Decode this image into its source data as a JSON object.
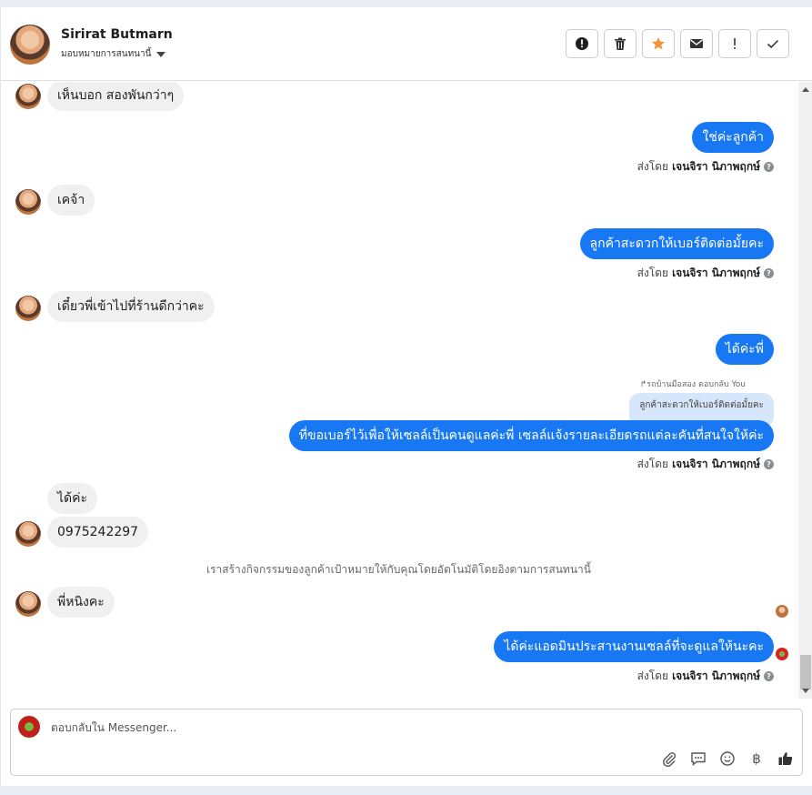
{
  "header": {
    "contact_name": "Sirirat Butmarn",
    "assign_label": "มอบหมายการสนทนานี้",
    "toolbar": [
      {
        "name": "spam-button",
        "icon": "alert-circle-icon"
      },
      {
        "name": "delete-button",
        "icon": "trash-icon"
      },
      {
        "name": "star-button",
        "icon": "star-icon"
      },
      {
        "name": "mark-unread-button",
        "icon": "envelope-icon"
      },
      {
        "name": "follow-up-button",
        "icon": "exclamation-icon"
      },
      {
        "name": "done-button",
        "icon": "check-icon"
      }
    ]
  },
  "messages": {
    "m1": "เห็นบอก สองพันกว่าๆ",
    "m2": "ใช่ค่ะลูกค้า",
    "m3": "เคจ้า",
    "m4": "ลูกค้าสะดวกให้เบอร์ติดต่อมั้ยคะ",
    "m5": "เดี๋ยวพี่เข้าไปที่ร้านดีกว่าคะ",
    "m6": "ได้ค่ะพี่",
    "m7": "ที่ขอเบอร์ไว้เพื่อให้เซลล์เป็นคนดูแลค่ะพี่ เซลล์แจ้งรายละเอียดรถแต่ละคันที่สนใจให้ค่ะ",
    "m8": "ได้ค่ะ",
    "m9": "0975242297",
    "m10": "พี่หนิงคะ",
    "m11": "ได้ค่ะแอดมินประสานงานเซลล์ที่จะดูแลให้นะคะ"
  },
  "sent_by": {
    "prefix": "ส่งโดย",
    "agent": "เจนจิรา นิภาพฤกษ์"
  },
  "reply_context": {
    "meta": "↱รถบ้านมือสอง ตอบกลับ You",
    "quoted": "ลูกค้าสะดวกให้เบอร์ติดต่อมั้ยคะ"
  },
  "system_note": "เราสร้างกิจกรรมของลูกค้าเป้าหมายให้กับคุณโดยอัตโนมัติโดยอิงตามการสนทนานี้",
  "composer": {
    "placeholder": "ตอบกลับใน Messenger...",
    "tools": [
      "paperclip-icon",
      "quick-reply-icon",
      "emoji-icon",
      "baht-icon",
      "thumbs-up-icon"
    ],
    "baht_symbol": "฿"
  },
  "colors": {
    "outgoing_bubble": "#1877f2",
    "incoming_bubble": "#f0f0f0",
    "quoted_bubble": "#d7e7fb",
    "star": "#f7923b"
  }
}
